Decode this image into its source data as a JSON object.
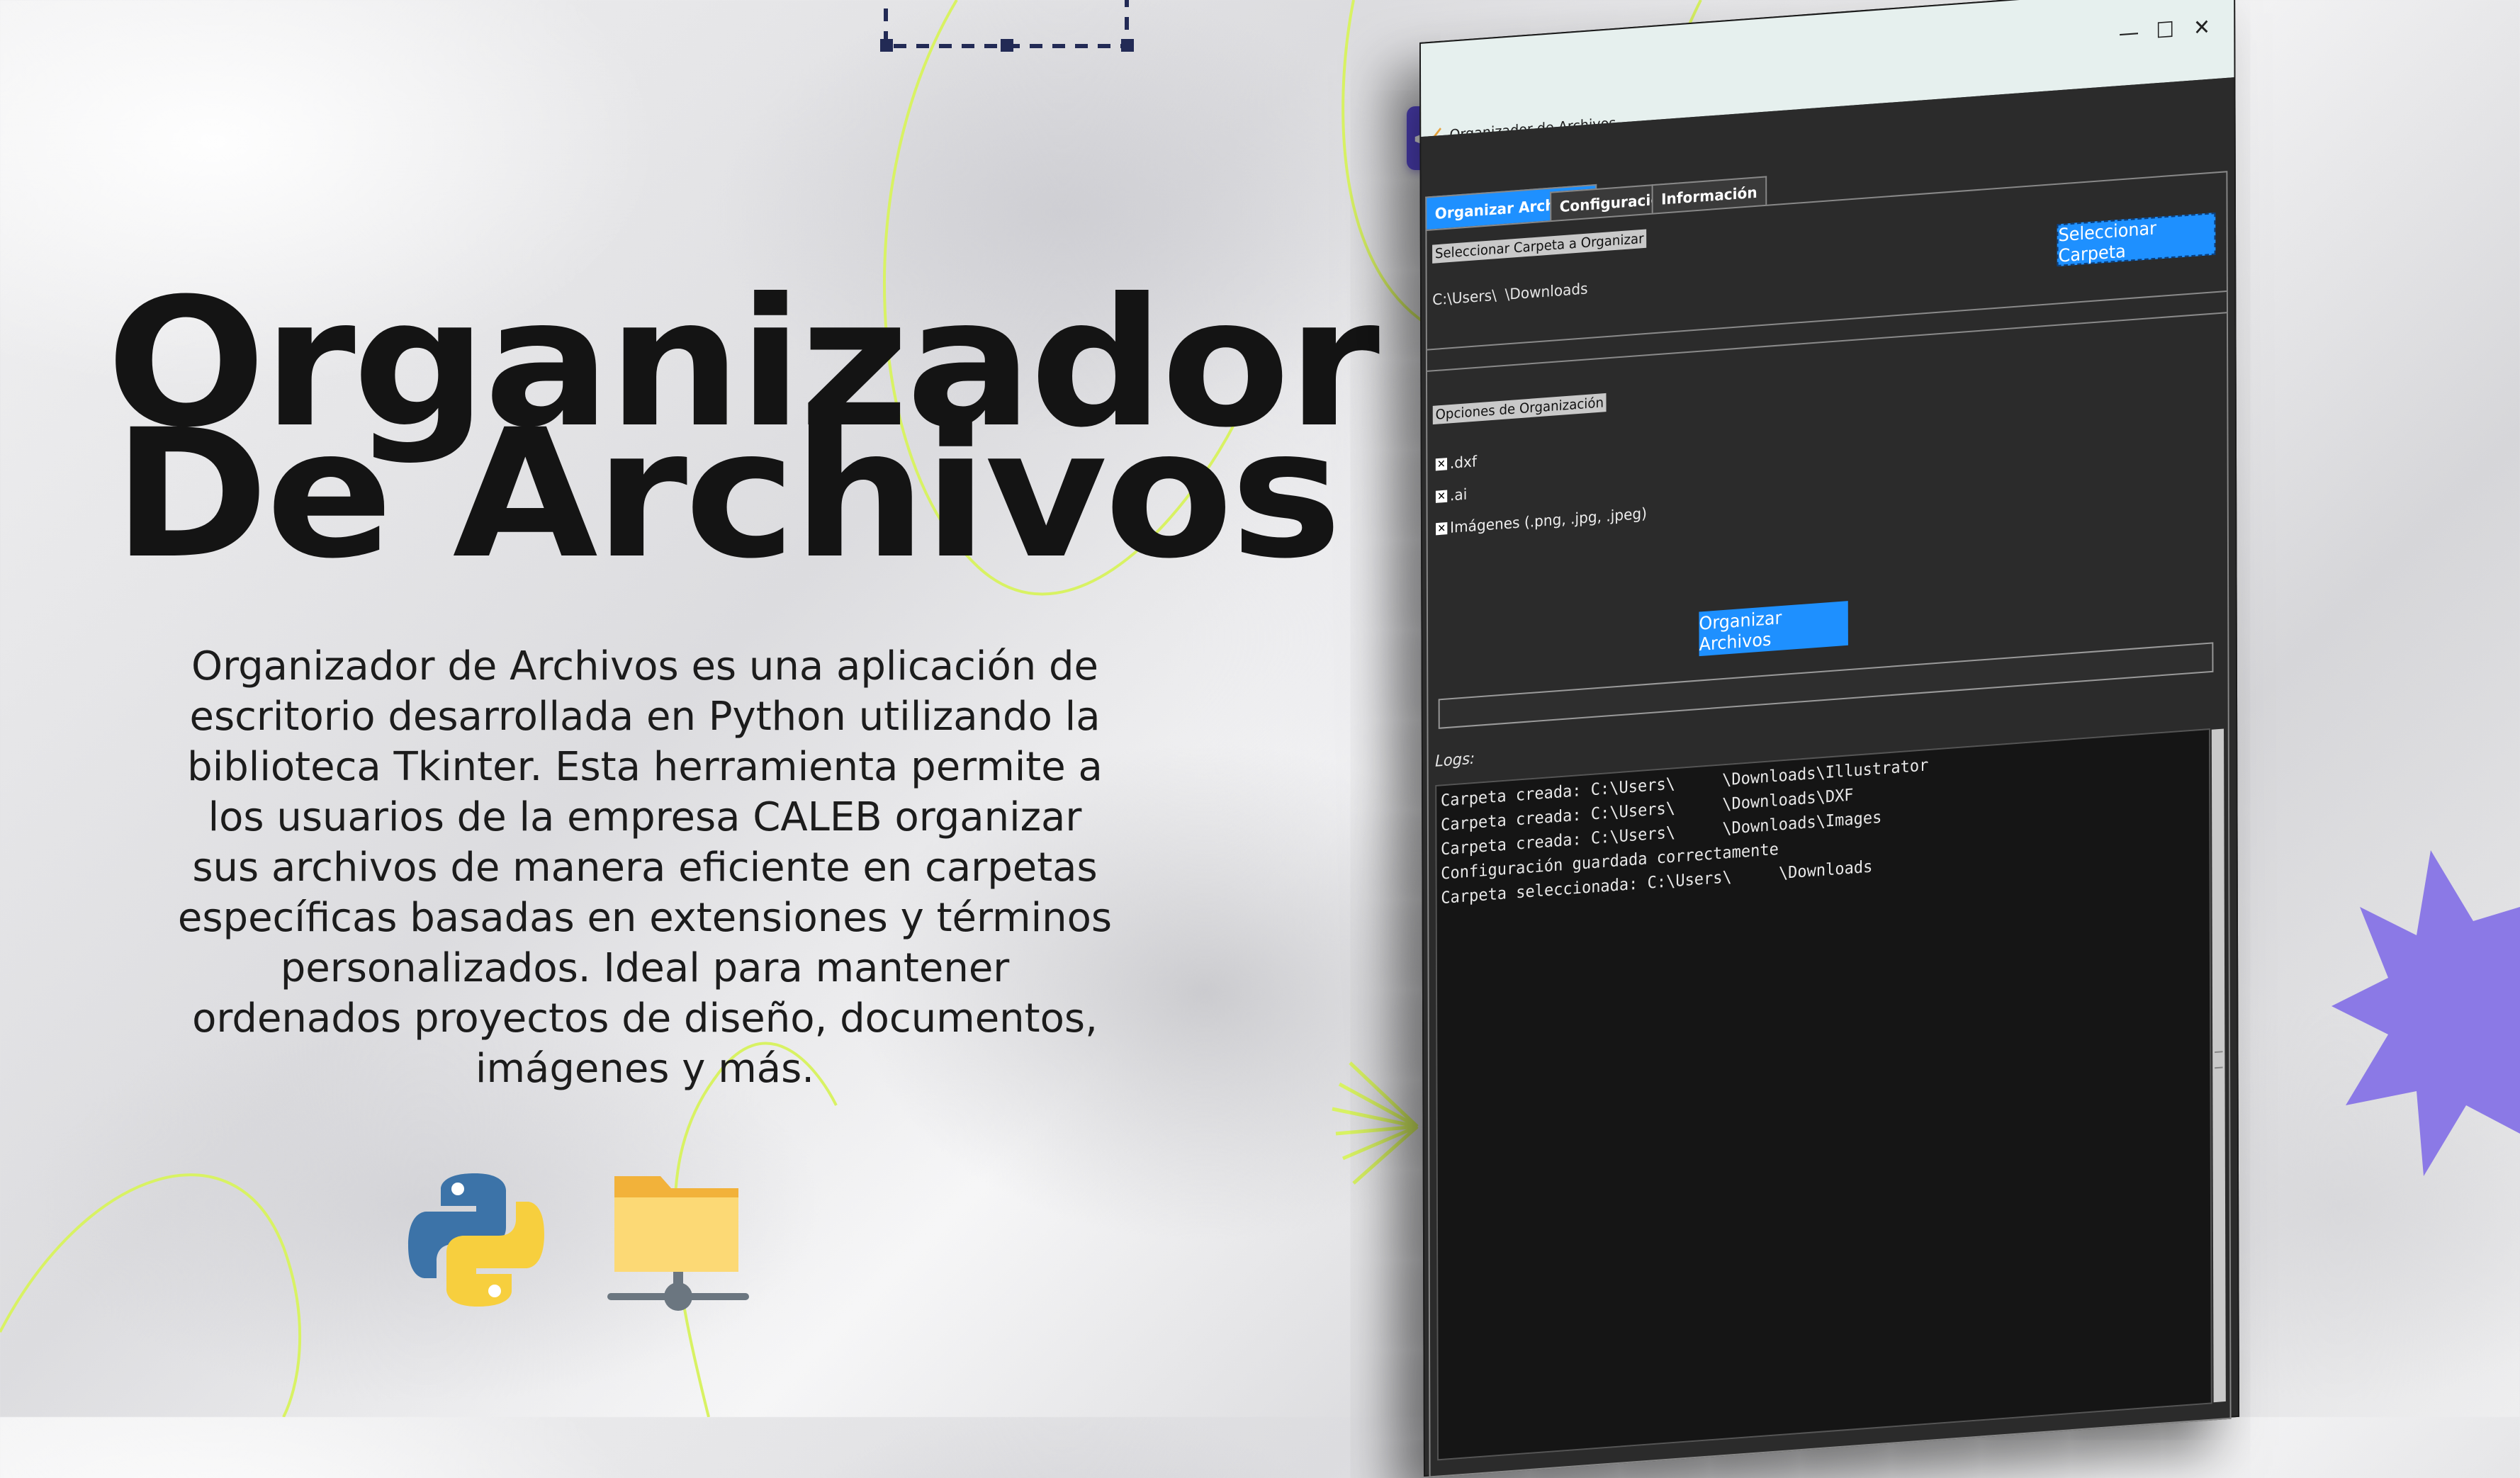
{
  "hero": {
    "title_line1": "Organizador",
    "title_line2": "De Archivos",
    "description": "Organizador de Archivos es una aplicación de escritorio desarrollada en Python utilizando la biblioteca Tkinter. Esta herramienta permite a los usuarios de la empresa CALEB organizar sus archivos de manera eficiente en carpetas específicas basadas en extensiones y términos personalizados. Ideal para mantener ordenados proyectos de diseño, documentos, imágenes y más.",
    "badge_text": "</>",
    "icons": [
      "python-logo",
      "folder-network-icon",
      "code-icon"
    ]
  },
  "colors": {
    "accent_blue": "#1e90ff",
    "badge_purple": "#5b4bd9",
    "lime_line": "#d8f263",
    "starburst_purple": "#8b79e6",
    "app_background": "#2b2b2b",
    "log_background": "#151515"
  },
  "app": {
    "window_title": "Organizador de Archivos",
    "window_controls": {
      "minimize": "—",
      "maximize": "☐",
      "close": "✕"
    },
    "tabs": [
      {
        "label": "Organizar Archivos",
        "active": true
      },
      {
        "label": "Configuración",
        "active": false
      },
      {
        "label": "Información",
        "active": false
      }
    ],
    "select_folder_label": "Seleccionar Carpeta a Organizar",
    "path_prefix": "C:\\Users\\",
    "path_suffix": "\\Downloads",
    "select_folder_button": "Seleccionar Carpeta",
    "options_label": "Opciones de Organización",
    "options": [
      {
        "label": ".dxf",
        "checked": true
      },
      {
        "label": ".ai",
        "checked": true
      },
      {
        "label": "Imágenes (.png, .jpg, .jpeg)",
        "checked": true
      }
    ],
    "check_mark": "✕",
    "organize_button": "Organizar Archivos",
    "progress": 0,
    "logs_label": "Logs:",
    "logs": [
      "Carpeta creada: C:\\Users\\     \\Downloads\\Illustrator",
      "Carpeta creada: C:\\Users\\     \\Downloads\\DXF",
      "Carpeta creada: C:\\Users\\     \\Downloads\\Images",
      "Configuración guardada correctamente",
      "Carpeta seleccionada: C:\\Users\\     \\Downloads"
    ]
  }
}
